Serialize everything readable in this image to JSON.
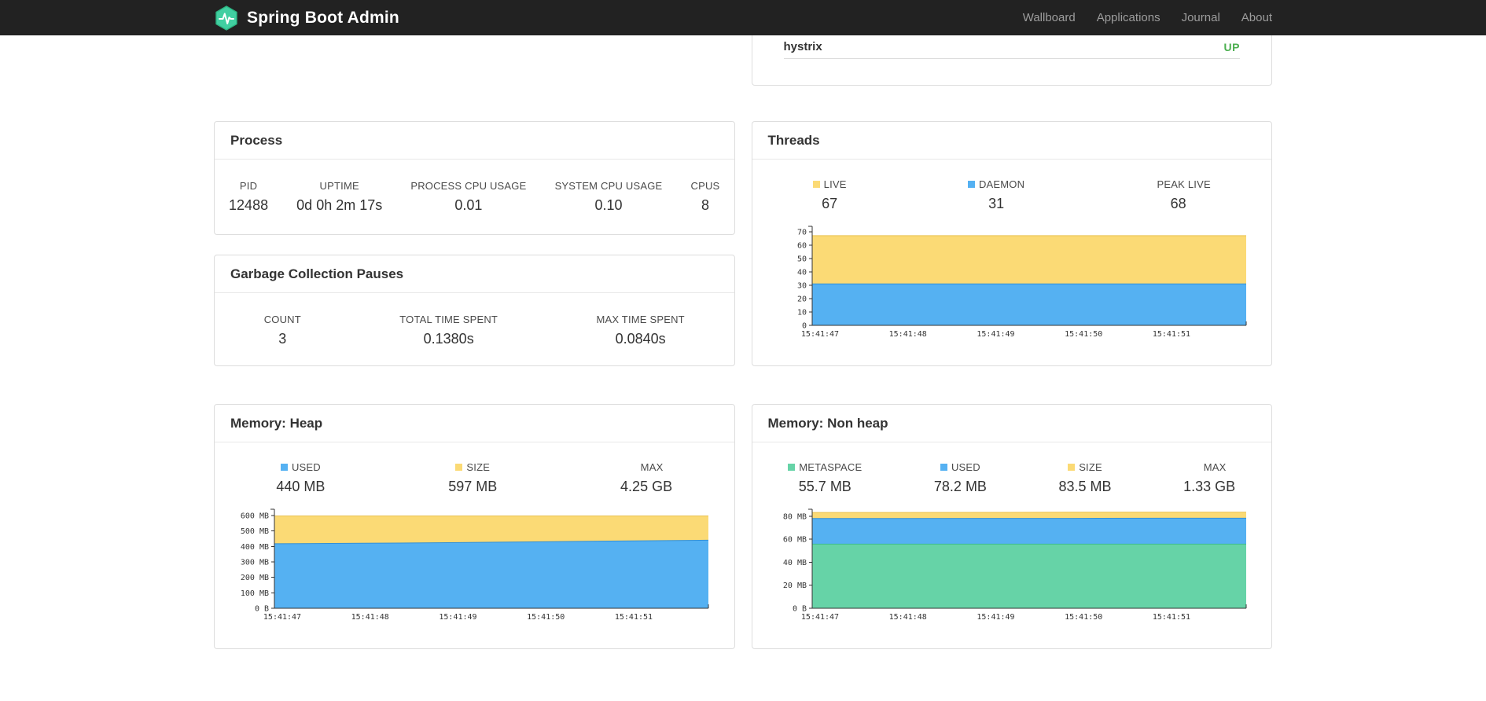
{
  "navbar": {
    "brand": "Spring Boot Admin",
    "links": [
      {
        "label": "Wallboard"
      },
      {
        "label": "Applications"
      },
      {
        "label": "Journal"
      },
      {
        "label": "About"
      }
    ]
  },
  "status_card": {
    "app_name": "hystrix",
    "status": "UP",
    "status_color": "#4caf50"
  },
  "process": {
    "title": "Process",
    "stats": [
      {
        "label": "PID",
        "value": "12488"
      },
      {
        "label": "UPTIME",
        "value": "0d 0h 2m 17s"
      },
      {
        "label": "PROCESS CPU USAGE",
        "value": "0.01"
      },
      {
        "label": "SYSTEM CPU USAGE",
        "value": "0.10"
      },
      {
        "label": "CPUS",
        "value": "8"
      }
    ]
  },
  "gc": {
    "title": "Garbage Collection Pauses",
    "stats": [
      {
        "label": "COUNT",
        "value": "3"
      },
      {
        "label": "TOTAL TIME SPENT",
        "value": "0.1380s"
      },
      {
        "label": "MAX TIME SPENT",
        "value": "0.0840s"
      }
    ]
  },
  "palette": {
    "yellow": {
      "fill": "#fbda75",
      "stroke": "#e9c250"
    },
    "blue": {
      "fill": "#55b1f2",
      "stroke": "#3390d6"
    },
    "green": {
      "fill": "#66d3a7",
      "stroke": "#3fbd8c"
    }
  },
  "ui_colors": {
    "navbar_bg": "#222222",
    "brand_green": "#41cfa1",
    "nav_link": "#9d9d9d",
    "card_border": "#dddddd",
    "status_up_green": "#4caf50"
  },
  "chart_data": [
    {
      "id": "threads",
      "type": "area",
      "title": "Threads",
      "legend_position": "top",
      "grid": false,
      "legend": [
        {
          "label": "LIVE",
          "value": "67",
          "swatch": "yellow"
        },
        {
          "label": "DAEMON",
          "value": "31",
          "swatch": "blue"
        },
        {
          "label": "PEAK LIVE",
          "value": "68"
        }
      ],
      "x_labels": [
        "15:41:47",
        "15:41:48",
        "15:41:49",
        "15:41:50",
        "15:41:51"
      ],
      "y_ticks": [
        {
          "v": 0,
          "label": "0"
        },
        {
          "v": 10,
          "label": "10"
        },
        {
          "v": 20,
          "label": "20"
        },
        {
          "v": 30,
          "label": "30"
        },
        {
          "v": 40,
          "label": "40"
        },
        {
          "v": 50,
          "label": "50"
        },
        {
          "v": 60,
          "label": "60"
        },
        {
          "v": 70,
          "label": "70"
        }
      ],
      "y_max": 74,
      "series": [
        {
          "name": "LIVE",
          "color": "yellow",
          "values": [
            67,
            67,
            67,
            67,
            67,
            67
          ]
        },
        {
          "name": "DAEMON",
          "color": "blue",
          "values": [
            31,
            31,
            31,
            31,
            31,
            31
          ]
        }
      ]
    },
    {
      "id": "heap",
      "type": "area",
      "title": "Memory: Heap",
      "legend_position": "top",
      "grid": false,
      "legend": [
        {
          "label": "USED",
          "value": "440 MB",
          "swatch": "blue"
        },
        {
          "label": "SIZE",
          "value": "597 MB",
          "swatch": "yellow"
        },
        {
          "label": "MAX",
          "value": "4.25 GB"
        }
      ],
      "x_labels": [
        "15:41:47",
        "15:41:48",
        "15:41:49",
        "15:41:50",
        "15:41:51"
      ],
      "y_ticks": [
        {
          "v": 0,
          "label": "0 B"
        },
        {
          "v": 100,
          "label": "100 MB"
        },
        {
          "v": 200,
          "label": "200 MB"
        },
        {
          "v": 300,
          "label": "300 MB"
        },
        {
          "v": 400,
          "label": "400 MB"
        },
        {
          "v": 500,
          "label": "500 MB"
        },
        {
          "v": 600,
          "label": "600 MB"
        }
      ],
      "y_max": 640,
      "y_unit": "MB",
      "series": [
        {
          "name": "SIZE",
          "color": "yellow",
          "values": [
            597,
            597,
            597,
            597,
            597,
            597
          ]
        },
        {
          "name": "USED",
          "color": "blue",
          "values": [
            417,
            420,
            424,
            429,
            435,
            440
          ]
        }
      ]
    },
    {
      "id": "nonheap",
      "type": "area",
      "title": "Memory: Non heap",
      "legend_position": "top",
      "grid": false,
      "legend": [
        {
          "label": "METASPACE",
          "value": "55.7 MB",
          "swatch": "green"
        },
        {
          "label": "USED",
          "value": "78.2 MB",
          "swatch": "blue"
        },
        {
          "label": "SIZE",
          "value": "83.5 MB",
          "swatch": "yellow"
        },
        {
          "label": "MAX",
          "value": "1.33 GB"
        }
      ],
      "x_labels": [
        "15:41:47",
        "15:41:48",
        "15:41:49",
        "15:41:50",
        "15:41:51"
      ],
      "y_ticks": [
        {
          "v": 0,
          "label": "0 B"
        },
        {
          "v": 20,
          "label": "20 MB"
        },
        {
          "v": 40,
          "label": "40 MB"
        },
        {
          "v": 60,
          "label": "60 MB"
        },
        {
          "v": 80,
          "label": "80 MB"
        }
      ],
      "y_max": 86,
      "y_unit": "MB",
      "series": [
        {
          "name": "SIZE",
          "color": "yellow",
          "values": [
            83.2,
            83.2,
            83.3,
            83.4,
            83.4,
            83.5
          ]
        },
        {
          "name": "USED",
          "color": "blue",
          "values": [
            78.0,
            78.0,
            78.1,
            78.1,
            78.2,
            78.2
          ]
        },
        {
          "name": "METASPACE",
          "color": "green",
          "values": [
            55.7,
            55.7,
            55.7,
            55.7,
            55.7,
            55.7
          ]
        }
      ]
    }
  ]
}
